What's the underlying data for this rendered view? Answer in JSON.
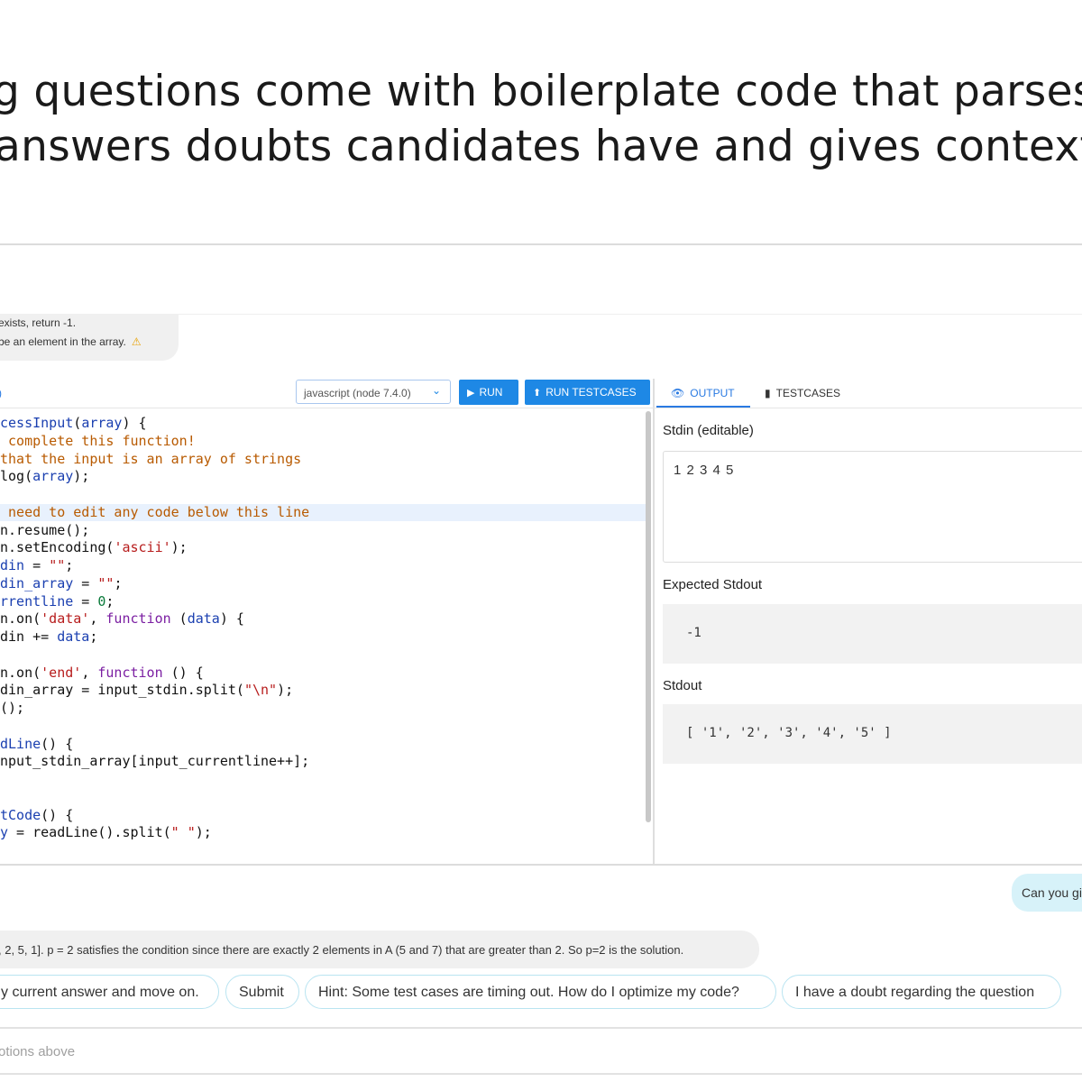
{
  "headline": {
    "line1": "g questions come with boilerplate code that parses the",
    "line2": "answers doubts candidates have and gives contextual h"
  },
  "question_bubble": {
    "line1": "exists, return -1.",
    "line2": "be an element in the array.",
    "warning_icon": "warning-icon"
  },
  "editor": {
    "file_tab": ")",
    "language": "javascript (node 7.4.0)",
    "run_label": "RUN",
    "run_testcases_label": "RUN TESTCASES"
  },
  "code_lines": [
    [
      [
        "fn",
        "cessInput"
      ],
      [
        "",
        "("
      ],
      [
        "vr",
        "array"
      ],
      [
        "",
        ") {"
      ]
    ],
    [
      [
        "cm",
        " complete this function!"
      ]
    ],
    [
      [
        "cm",
        "that the input is an array of strings"
      ]
    ],
    [
      [
        "",
        "log("
      ],
      [
        "vr",
        "array"
      ],
      [
        "",
        ");"
      ]
    ],
    [],
    [
      [
        "cm",
        " need to edit any code below this line"
      ]
    ],
    [
      [
        "",
        "n.resume();"
      ]
    ],
    [
      [
        "",
        "n.setEncoding("
      ],
      [
        "st",
        "'ascii'"
      ],
      [
        "",
        ");"
      ]
    ],
    [
      [
        "vr",
        "din"
      ],
      [
        "",
        " = "
      ],
      [
        "st",
        "\"\""
      ],
      [
        "",
        ";"
      ]
    ],
    [
      [
        "vr",
        "din_array"
      ],
      [
        "",
        " = "
      ],
      [
        "st",
        "\"\""
      ],
      [
        "",
        ";"
      ]
    ],
    [
      [
        "vr",
        "rrentline"
      ],
      [
        "",
        " = "
      ],
      [
        "nm",
        "0"
      ],
      [
        "",
        ";"
      ]
    ],
    [
      [
        "",
        "n.on("
      ],
      [
        "st",
        "'data'"
      ],
      [
        "",
        ", "
      ],
      [
        "kw",
        "function"
      ],
      [
        "",
        " ("
      ],
      [
        "vr",
        "data"
      ],
      [
        "",
        ") {"
      ]
    ],
    [
      [
        "",
        "din += "
      ],
      [
        "vr",
        "data"
      ],
      [
        "",
        ";"
      ]
    ],
    [],
    [
      [
        "",
        "n.on("
      ],
      [
        "st",
        "'end'"
      ],
      [
        "",
        ", "
      ],
      [
        "kw",
        "function"
      ],
      [
        "",
        " () {"
      ]
    ],
    [
      [
        "",
        "din_array = input_stdin.split("
      ],
      [
        "st",
        "\"\\n\""
      ],
      [
        "",
        ");"
      ]
    ],
    [
      [
        "",
        "();"
      ]
    ],
    [],
    [
      [
        "fn",
        "dLine"
      ],
      [
        "",
        "() {"
      ]
    ],
    [
      [
        "",
        "nput_stdin_array[input_currentline++];"
      ]
    ],
    [],
    [],
    [
      [
        "fn",
        "tCode"
      ],
      [
        "",
        "() {"
      ]
    ],
    [
      [
        "vr",
        "y"
      ],
      [
        "",
        " = readLine().split("
      ],
      [
        "st",
        "\" \""
      ],
      [
        "",
        ");"
      ]
    ]
  ],
  "output_panel": {
    "tab_output": "OUTPUT",
    "tab_testcases": "TESTCASES",
    "stdin_label": "Stdin (editable)",
    "stdin_value": "1 2 3 4 5",
    "expected_label": "Expected Stdout",
    "expected_value": "-1",
    "stdout_label": "Stdout",
    "stdout_value": "[ '1', '2', '3', '4', '5' ]"
  },
  "chat": {
    "user_message": "Can you gi",
    "hint_message": ", 2, 5, 1]. p = 2 satisfies the condition since there are exactly 2 elements in A (5 and 7) that are greater than 2. So p=2 is the solution.",
    "chips": [
      "y current answer and move on.",
      "Submit",
      "Hint: Some test cases are timing out. How do I optimize my code?",
      "I have a doubt regarding the question"
    ],
    "input_placeholder": "otions above"
  },
  "colors": {
    "accent": "#1e88e5",
    "user_bubble": "#d7f2f9",
    "chip_border": "#b9e4f1",
    "highlight_line": "#e8f1fd"
  }
}
